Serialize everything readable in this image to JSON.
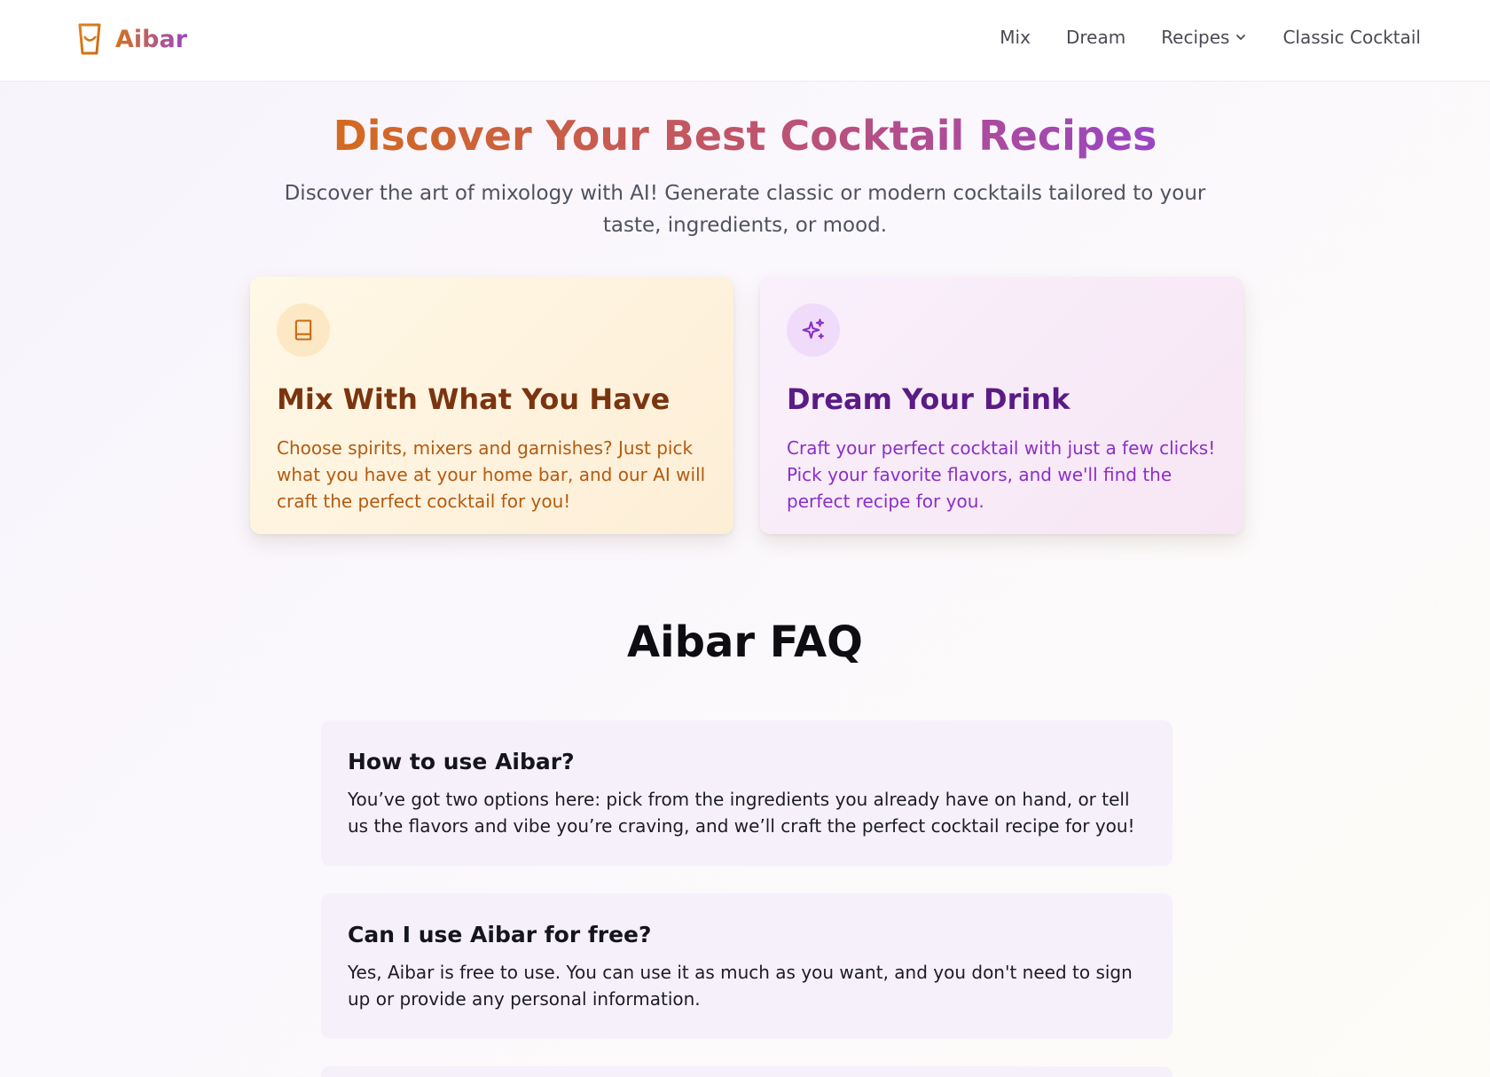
{
  "header": {
    "brand": "Aibar",
    "nav": [
      {
        "label": "Mix"
      },
      {
        "label": "Dream"
      },
      {
        "label": "Recipes",
        "has_dropdown": true
      },
      {
        "label": "Classic Cocktail"
      }
    ]
  },
  "hero": {
    "title": "Discover Your Best Cocktail Recipes",
    "subtitle": "Discover the art of mixology with AI! Generate classic or modern cocktails tailored to your taste, ingredients, or mood."
  },
  "cards": [
    {
      "icon": "book-icon",
      "title": "Mix With What You Have",
      "description": "Choose spirits, mixers and garnishes? Just pick what you have at your home bar, and our AI will craft the perfect cocktail for you!"
    },
    {
      "icon": "sparkles-icon",
      "title": "Dream Your Drink",
      "description": "Craft your perfect cocktail with just a few clicks! Pick your favorite flavors, and we'll find the perfect recipe for you."
    }
  ],
  "faq": {
    "title": "Aibar FAQ",
    "items": [
      {
        "question": "How to use Aibar?",
        "answer": "You’ve got two options here: pick from the ingredients you already have on hand, or tell us the flavors and vibe you’re craving, and we’ll craft the perfect cocktail recipe for you!"
      },
      {
        "question": "Can I use Aibar for free?",
        "answer": "Yes, Aibar is free to use. You can use it as much as you want, and you don't need to sign up or provide any personal information."
      }
    ]
  },
  "colors": {
    "brand_orange": "#d4731f",
    "brand_purple": "#9b45c4",
    "mix_card_bg": "#fff8e6",
    "dream_card_bg": "#f9f0fc",
    "faq_item_bg": "#f6f0fb"
  }
}
